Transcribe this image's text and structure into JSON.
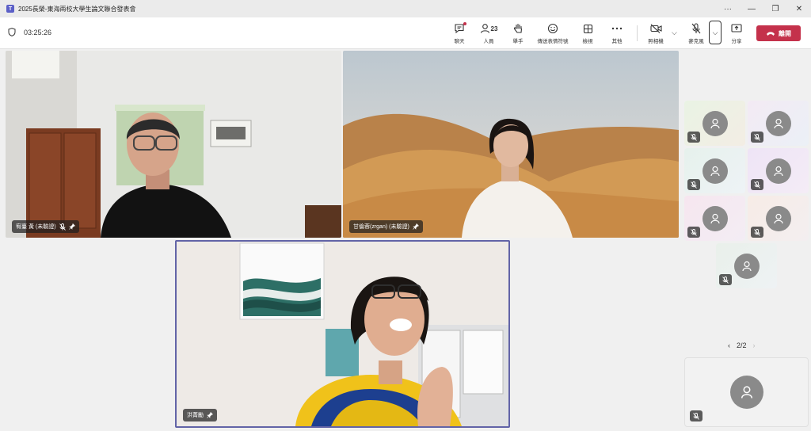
{
  "window": {
    "title": "2025長榮-東海兩校大學生論文聯合發表會",
    "app_icon": "teams-icon",
    "controls": [
      "···",
      "—",
      "❐",
      "✕"
    ]
  },
  "toolbar": {
    "timer": "03:25:26",
    "chat_label": "聊天",
    "people_label": "人員",
    "people_count": "23",
    "raise_label": "舉手",
    "react_label": "傳送表情符號",
    "view_label": "檢視",
    "more_label": "其他",
    "camera_label": "照相機",
    "mic_label": "麥克風",
    "share_label": "分享",
    "leave_label": "離開"
  },
  "participants": {
    "tile1_name": "宥臺 黃 (未驗證)",
    "tile2_name": "甘倫蓉(zrgan) (未驗證)",
    "tile3_name": "洪菁勵"
  },
  "pager": {
    "text": "2/2"
  },
  "colors": {
    "accent": "#5b5fc7",
    "leave": "#c4314b",
    "active_speaker_border": "#6264a7"
  }
}
